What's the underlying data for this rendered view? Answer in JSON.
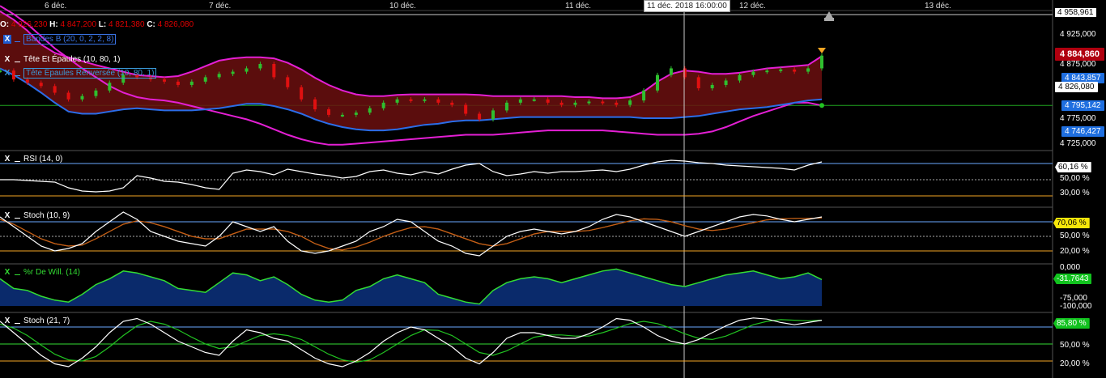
{
  "dates": [
    "6 déc.",
    "7 déc.",
    "10 déc.",
    "11 déc.",
    "12 déc.",
    "13 déc."
  ],
  "cursor_label": "11 déc. 2018 16:00:00",
  "ohlc": {
    "o_label": "O:",
    "o_value": "4 926,230",
    "h_label": "H:",
    "h_value": "4 847,200",
    "l_label": "L:",
    "l_value": "4 821,380",
    "c_label": "C:",
    "c_value": "4 826,080"
  },
  "main_indicators": [
    {
      "x": "X",
      "name": "Bandes B (20, 0, 2, 2, 8)",
      "color": "#3a74e6"
    },
    {
      "x": "X",
      "name": "Tête Et Épaules (10, 80, 1)",
      "color": "#ffffff"
    },
    {
      "x": "X",
      "name": "Tête Épaules Renversée (10, 80, 1)",
      "color": "#3a9ad9"
    }
  ],
  "price_axis": [
    "4 958,961",
    "4 925,000",
    "4 875,000",
    "4 826,080",
    "4 775,000",
    "4 725,000"
  ],
  "price_tags": {
    "last": "4 884,860",
    "upper_band": "4 843,857",
    "lower_band": "4 795,142",
    "lower_band2": "4 746,427",
    "cursor": "4 826,080"
  },
  "panels": [
    {
      "name": "RSI (14, 0)",
      "color": "#ffffff",
      "axis": [
        "50,00 %",
        "30,00 %"
      ],
      "tag": "60,16 %",
      "tag_style": "white"
    },
    {
      "name": "Stoch (10, 9)",
      "color": "#ffffff",
      "axis": [
        "50,00 %",
        "20,00 %"
      ],
      "tag": "70,06 %",
      "tag_style": "yellow"
    },
    {
      "name": "%r De Will. (14)",
      "color": "#33dd33",
      "axis": [
        "0,000",
        "-75,000",
        "-100,000"
      ],
      "tag": "-31,7643",
      "tag_style": "green"
    },
    {
      "name": "Stoch (21, 7)",
      "color": "#ffffff",
      "axis": [
        "50,00 %",
        "20,00 %"
      ],
      "tag": "85,80 %",
      "tag_style": "green"
    }
  ],
  "chart_data": {
    "type": "line",
    "price": {
      "values": [
        4858,
        4842,
        4836,
        4830,
        4818,
        4806,
        4812,
        4822,
        4836,
        4850,
        4846,
        4842,
        4838,
        4832,
        4838,
        4846,
        4852,
        4856,
        4862,
        4870,
        4846,
        4828,
        4806,
        4788,
        4778,
        4778,
        4782,
        4790,
        4800,
        4806,
        4804,
        4806,
        4800,
        4796,
        4780,
        4770,
        4786,
        4800,
        4806,
        4806,
        4800,
        4796,
        4800,
        4802,
        4800,
        4796,
        4804,
        4822,
        4850,
        4862,
        4846,
        4826,
        4832,
        4840,
        4850,
        4856,
        4858,
        4860,
        4856,
        4862,
        4885
      ],
      "upper_band": [
        4965,
        4950,
        4930,
        4905,
        4890,
        4882,
        4875,
        4868,
        4862,
        4856,
        4850,
        4848,
        4846,
        4848,
        4856,
        4866,
        4876,
        4880,
        4882,
        4882,
        4880,
        4872,
        4860,
        4845,
        4832,
        4822,
        4815,
        4812,
        4812,
        4814,
        4815,
        4815,
        4815,
        4815,
        4815,
        4814,
        4812,
        4812,
        4812,
        4812,
        4812,
        4812,
        4810,
        4810,
        4808,
        4808,
        4810,
        4820,
        4838,
        4852,
        4858,
        4856,
        4852,
        4852,
        4854,
        4858,
        4862,
        4864,
        4866,
        4868,
        4884
      ],
      "lower_band": [
        4862,
        4850,
        4835,
        4818,
        4800,
        4784,
        4780,
        4780,
        4784,
        4788,
        4790,
        4788,
        4786,
        4786,
        4786,
        4788,
        4790,
        4794,
        4798,
        4798,
        4794,
        4788,
        4780,
        4770,
        4762,
        4756,
        4752,
        4750,
        4750,
        4752,
        4756,
        4760,
        4762,
        4766,
        4768,
        4768,
        4770,
        4772,
        4774,
        4774,
        4774,
        4774,
        4774,
        4774,
        4774,
        4774,
        4774,
        4772,
        4772,
        4772,
        4774,
        4776,
        4780,
        4784,
        4788,
        4790,
        4792,
        4796,
        4800,
        4804,
        4806
      ],
      "outer_band": [
        4975,
        4960,
        4942,
        4920,
        4898,
        4880,
        4862,
        4846,
        4830,
        4818,
        4810,
        4806,
        4804,
        4800,
        4794,
        4788,
        4782,
        4776,
        4770,
        4762,
        4752,
        4742,
        4734,
        4728,
        4724,
        4724,
        4726,
        4728,
        4730,
        4732,
        4734,
        4736,
        4738,
        4740,
        4742,
        4742,
        4742,
        4744,
        4746,
        4748,
        4750,
        4750,
        4750,
        4750,
        4750,
        4748,
        4746,
        4744,
        4742,
        4742,
        4742,
        4744,
        4748,
        4756,
        4766,
        4776,
        4784,
        4792,
        4800,
        4800,
        4795
      ],
      "ylim": [
        4715,
        4965
      ]
    },
    "rsi": {
      "values": [
        50,
        50,
        49,
        48,
        47,
        40,
        36,
        35,
        36,
        40,
        55,
        52,
        48,
        47,
        44,
        40,
        38,
        58,
        62,
        60,
        56,
        63,
        60,
        57,
        55,
        52,
        54,
        60,
        62,
        58,
        56,
        60,
        57,
        63,
        68,
        70,
        60,
        55,
        57,
        60,
        58,
        60,
        60,
        61,
        62,
        60,
        63,
        68,
        72,
        74,
        73,
        71,
        70,
        68,
        67,
        66,
        65,
        64,
        62,
        68,
        72
      ],
      "ylim": [
        20,
        80
      ]
    },
    "stoch_10": {
      "k": [
        90,
        70,
        50,
        30,
        20,
        25,
        35,
        60,
        80,
        100,
        85,
        60,
        50,
        40,
        35,
        30,
        50,
        80,
        70,
        60,
        70,
        40,
        20,
        15,
        20,
        30,
        40,
        60,
        70,
        85,
        80,
        60,
        40,
        30,
        15,
        10,
        30,
        50,
        60,
        65,
        60,
        55,
        60,
        70,
        85,
        95,
        90,
        80,
        70,
        60,
        50,
        60,
        70,
        80,
        90,
        95,
        92,
        85,
        80,
        85,
        90
      ],
      "d": [
        85,
        75,
        60,
        45,
        35,
        30,
        32,
        45,
        60,
        75,
        82,
        78,
        70,
        60,
        50,
        45,
        45,
        55,
        65,
        65,
        65,
        60,
        50,
        35,
        25,
        22,
        28,
        38,
        50,
        60,
        68,
        70,
        65,
        55,
        45,
        35,
        30,
        35,
        45,
        55,
        60,
        60,
        60,
        62,
        68,
        75,
        82,
        86,
        85,
        80,
        72,
        65,
        62,
        65,
        72,
        78,
        84,
        86,
        87,
        87,
        88
      ],
      "ylim": [
        0,
        100
      ]
    },
    "williams": {
      "values": [
        -30,
        -55,
        -60,
        -75,
        -85,
        -90,
        -70,
        -45,
        -30,
        -10,
        -15,
        -25,
        -35,
        -55,
        -60,
        -65,
        -40,
        -15,
        -20,
        -35,
        -25,
        -45,
        -70,
        -85,
        -90,
        -85,
        -60,
        -50,
        -30,
        -20,
        -30,
        -40,
        -70,
        -80,
        -90,
        -95,
        -60,
        -40,
        -30,
        -25,
        -30,
        -40,
        -30,
        -20,
        -10,
        -5,
        -15,
        -25,
        -35,
        -45,
        -50,
        -40,
        -30,
        -20,
        -15,
        -10,
        -20,
        -30,
        -25,
        -15,
        -32
      ],
      "ylim": [
        -100,
        0
      ]
    },
    "stoch_21": {
      "k": [
        90,
        70,
        50,
        30,
        15,
        10,
        25,
        45,
        70,
        90,
        95,
        85,
        70,
        55,
        45,
        35,
        30,
        55,
        75,
        70,
        60,
        55,
        40,
        25,
        15,
        10,
        20,
        35,
        55,
        70,
        80,
        75,
        60,
        45,
        25,
        15,
        35,
        60,
        70,
        70,
        65,
        60,
        60,
        68,
        80,
        95,
        92,
        80,
        65,
        55,
        50,
        58,
        70,
        82,
        92,
        96,
        94,
        88,
        84,
        88,
        92
      ],
      "d": [
        85,
        78,
        65,
        48,
        32,
        22,
        20,
        28,
        45,
        65,
        82,
        90,
        85,
        75,
        62,
        50,
        42,
        45,
        55,
        65,
        68,
        65,
        58,
        45,
        32,
        22,
        18,
        22,
        35,
        50,
        65,
        75,
        74,
        65,
        50,
        35,
        30,
        38,
        50,
        62,
        66,
        66,
        64,
        64,
        70,
        78,
        86,
        90,
        86,
        78,
        68,
        60,
        58,
        64,
        74,
        84,
        90,
        93,
        92,
        91,
        92
      ],
      "ylim": [
        0,
        100
      ]
    }
  }
}
